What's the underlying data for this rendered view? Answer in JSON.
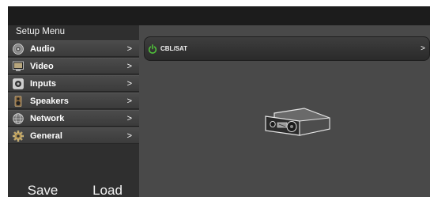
{
  "sidebar": {
    "title": "Setup Menu",
    "items": [
      {
        "label": "Audio",
        "icon": "speaker-icon",
        "chevron": ">"
      },
      {
        "label": "Video",
        "icon": "monitor-icon",
        "chevron": ">"
      },
      {
        "label": "Inputs",
        "icon": "input-icon",
        "chevron": ">"
      },
      {
        "label": "Speakers",
        "icon": "speakers-icon",
        "chevron": ">"
      },
      {
        "label": "Network",
        "icon": "globe-icon",
        "chevron": ">"
      },
      {
        "label": "General",
        "icon": "gear-icon",
        "chevron": ">"
      }
    ],
    "save_label": "Save",
    "load_label": "Load"
  },
  "main": {
    "source_label": "CBL/SAT",
    "source_chevron": ">",
    "power_color": "#4fbf3a"
  }
}
